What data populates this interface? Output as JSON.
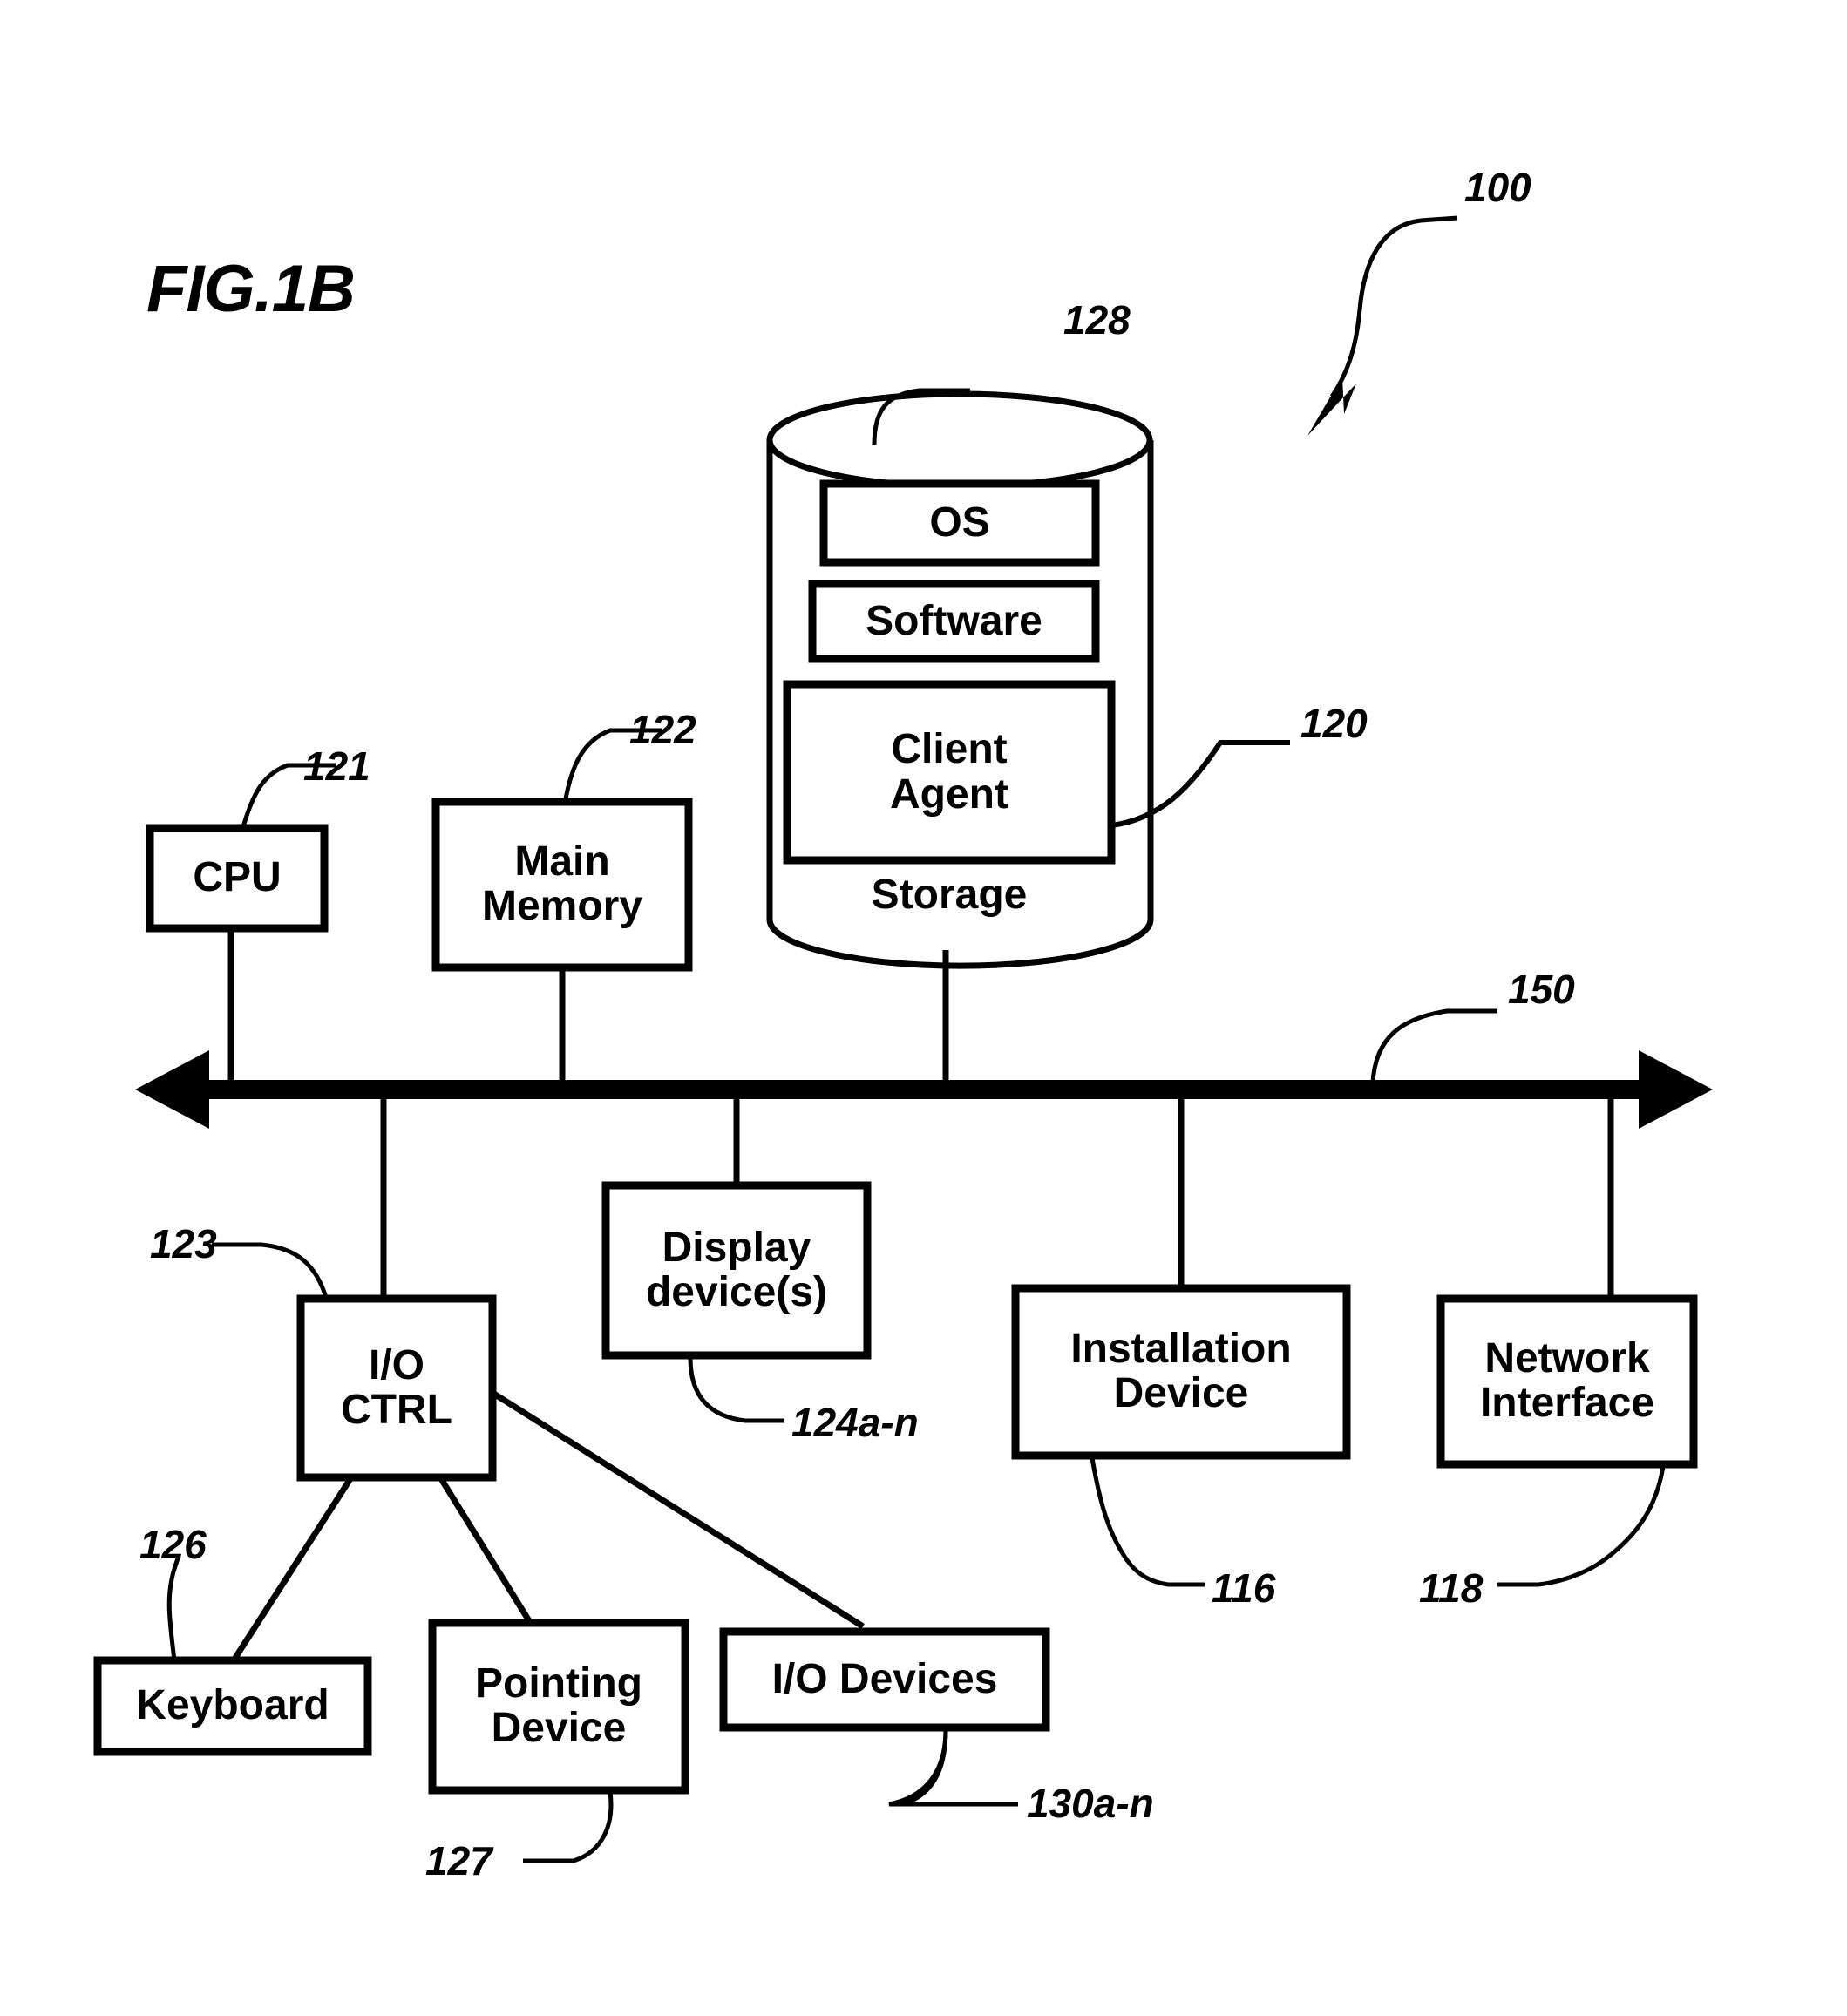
{
  "figure": {
    "title": "FIG.1B",
    "system_ref": "100"
  },
  "colors": {
    "ink": "#000000",
    "paper": "#ffffff"
  },
  "storage": {
    "label": "Storage",
    "ref": "128",
    "contents": [
      {
        "label": "OS",
        "ref": ""
      },
      {
        "label": "Software",
        "ref": ""
      },
      {
        "label": "Client\nAgent",
        "ref": "120"
      }
    ]
  },
  "bus": {
    "ref": "150"
  },
  "blocks": [
    {
      "key": "cpu",
      "label": "CPU",
      "ref": "121"
    },
    {
      "key": "main_memory",
      "label": "Main\nMemory",
      "ref": "122"
    },
    {
      "key": "io_ctrl",
      "label": "I/O\nCTRL",
      "ref": "123"
    },
    {
      "key": "display",
      "label": "Display\ndevice(s)",
      "ref": "124a-n"
    },
    {
      "key": "installation",
      "label": "Installation\nDevice",
      "ref": "116"
    },
    {
      "key": "network",
      "label": "Network\nInterface",
      "ref": "118"
    },
    {
      "key": "keyboard",
      "label": "Keyboard",
      "ref": "126"
    },
    {
      "key": "pointing",
      "label": "Pointing\nDevice",
      "ref": "127"
    },
    {
      "key": "io_devices",
      "label": "I/O Devices",
      "ref": "130a-n"
    }
  ]
}
